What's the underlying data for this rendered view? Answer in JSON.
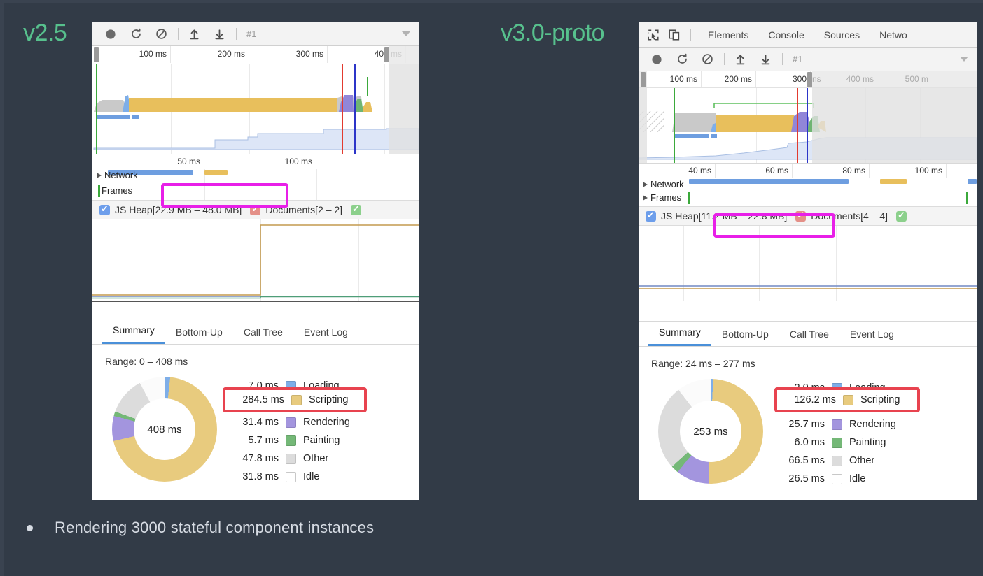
{
  "slide": {
    "background": "#323b47",
    "accent_green": "#57c08d",
    "bullet": {
      "text": "Rendering 3000 stateful component instances",
      "marker": "bullet-dot"
    }
  },
  "left": {
    "version_label": "v2.5",
    "toolbar": {
      "record_icon": "record-circle-icon",
      "reload_icon": "reload-icon",
      "clear_icon": "clear-prohibited-icon",
      "upload_icon": "upload-arrow-icon",
      "download_icon": "download-arrow-icon",
      "session": "#1",
      "more_icon": "chevron-down-icon"
    },
    "overview_ruler": {
      "ticks": [
        "100 ms",
        "200 ms",
        "300 ms",
        "400 ms"
      ],
      "dim_ticks": []
    },
    "zoom_ruler": {
      "ticks": [
        "50 ms",
        "100 ms"
      ]
    },
    "tracks": [
      {
        "name": "Network",
        "expander": "triangle-right-icon"
      },
      {
        "name": "Frames",
        "expander": ""
      }
    ],
    "counters": [
      {
        "label": "JS Heap",
        "value": "[22.9 MB – 48.0 MB]",
        "color": "#6d9eeb",
        "checked": true
      },
      {
        "label": "Documents",
        "value": "[2 – 2]",
        "color": "#e49088",
        "checked": true
      },
      {
        "label": "",
        "value": "",
        "color": "#8cd08c",
        "checked": true
      }
    ],
    "detail_tabs": [
      {
        "label": "Summary",
        "active": true
      },
      {
        "label": "Bottom-Up",
        "active": false
      },
      {
        "label": "Call Tree",
        "active": false
      },
      {
        "label": "Event Log",
        "active": false
      }
    ],
    "range": "Range: 0 – 408 ms",
    "chart_data": {
      "type": "pie",
      "title": "Range: 0 – 408 ms",
      "center_label": "408 ms",
      "total": "408 ms",
      "unit": "ms",
      "legend_position": "right",
      "categories": [
        "Loading",
        "Scripting",
        "Rendering",
        "Painting",
        "Other",
        "Idle"
      ],
      "values": [
        7.0,
        284.5,
        31.4,
        5.7,
        47.8,
        31.8
      ],
      "value_labels": [
        "7.0 ms",
        "284.5 ms",
        "31.4 ms",
        "5.7 ms",
        "47.8 ms",
        "31.8 ms"
      ],
      "colors": [
        "#7eaee8",
        "#e8cb7e",
        "#a395de",
        "#74b877",
        "#dcdcdc",
        "#ffffff"
      ]
    },
    "highlight_magenta": "[22.9 MB – 48.0 MB]",
    "highlight_red": {
      "value": "284.5 ms",
      "label": "Scripting"
    }
  },
  "right": {
    "version_label": "v3.0-proto",
    "devtools_tabs": [
      {
        "label": "inspect-element-icon",
        "icon": true
      },
      {
        "label": "device-toolbar-icon",
        "icon": true
      },
      {
        "label": "Elements",
        "icon": false
      },
      {
        "label": "Console",
        "icon": false
      },
      {
        "label": "Sources",
        "icon": false
      },
      {
        "label": "Netwo",
        "icon": false
      }
    ],
    "toolbar": {
      "record_icon": "record-circle-icon",
      "reload_icon": "reload-icon",
      "clear_icon": "clear-prohibited-icon",
      "upload_icon": "upload-arrow-icon",
      "download_icon": "download-arrow-icon",
      "session": "#1",
      "more_icon": "chevron-down-icon"
    },
    "overview_ruler": {
      "ticks": [
        "100 ms",
        "200 ms",
        "300"
      ],
      "dim_ticks": [
        "ns",
        "400 ms",
        "500 m"
      ]
    },
    "zoom_ruler": {
      "ticks": [
        "40 ms",
        "60 ms",
        "80 ms",
        "100 ms"
      ]
    },
    "tracks": [
      {
        "name": "Network",
        "expander": "triangle-right-icon"
      },
      {
        "name": "Frames",
        "expander": "triangle-right-icon"
      }
    ],
    "counters": [
      {
        "label": "JS Heap",
        "value": "[11.2 MB – 22.8 MB]",
        "color": "#6d9eeb",
        "checked": true
      },
      {
        "label": "Documents",
        "value": "[4 – 4]",
        "color": "#e49088",
        "checked": true
      },
      {
        "label": "",
        "value": "",
        "color": "#8cd08c",
        "checked": true
      }
    ],
    "detail_tabs": [
      {
        "label": "Summary",
        "active": true
      },
      {
        "label": "Bottom-Up",
        "active": false
      },
      {
        "label": "Call Tree",
        "active": false
      },
      {
        "label": "Event Log",
        "active": false
      }
    ],
    "range": "Range: 24 ms – 277 ms",
    "chart_data": {
      "type": "pie",
      "title": "Range: 24 ms – 277 ms",
      "center_label": "253 ms",
      "total": "253 ms",
      "unit": "ms",
      "legend_position": "right",
      "categories": [
        "Loading",
        "Scripting",
        "Rendering",
        "Painting",
        "Other",
        "Idle"
      ],
      "values": [
        2.0,
        126.2,
        25.7,
        6.0,
        66.5,
        26.5
      ],
      "value_labels": [
        "2.0 ms",
        "126.2 ms",
        "25.7 ms",
        "6.0 ms",
        "66.5 ms",
        "26.5 ms"
      ],
      "colors": [
        "#7eaee8",
        "#e8cb7e",
        "#a395de",
        "#74b877",
        "#dcdcdc",
        "#ffffff"
      ]
    },
    "highlight_magenta": "[11.2 MB – 22.8 MB]",
    "highlight_red": {
      "value": "126.2 ms",
      "label": "Scripting"
    }
  }
}
